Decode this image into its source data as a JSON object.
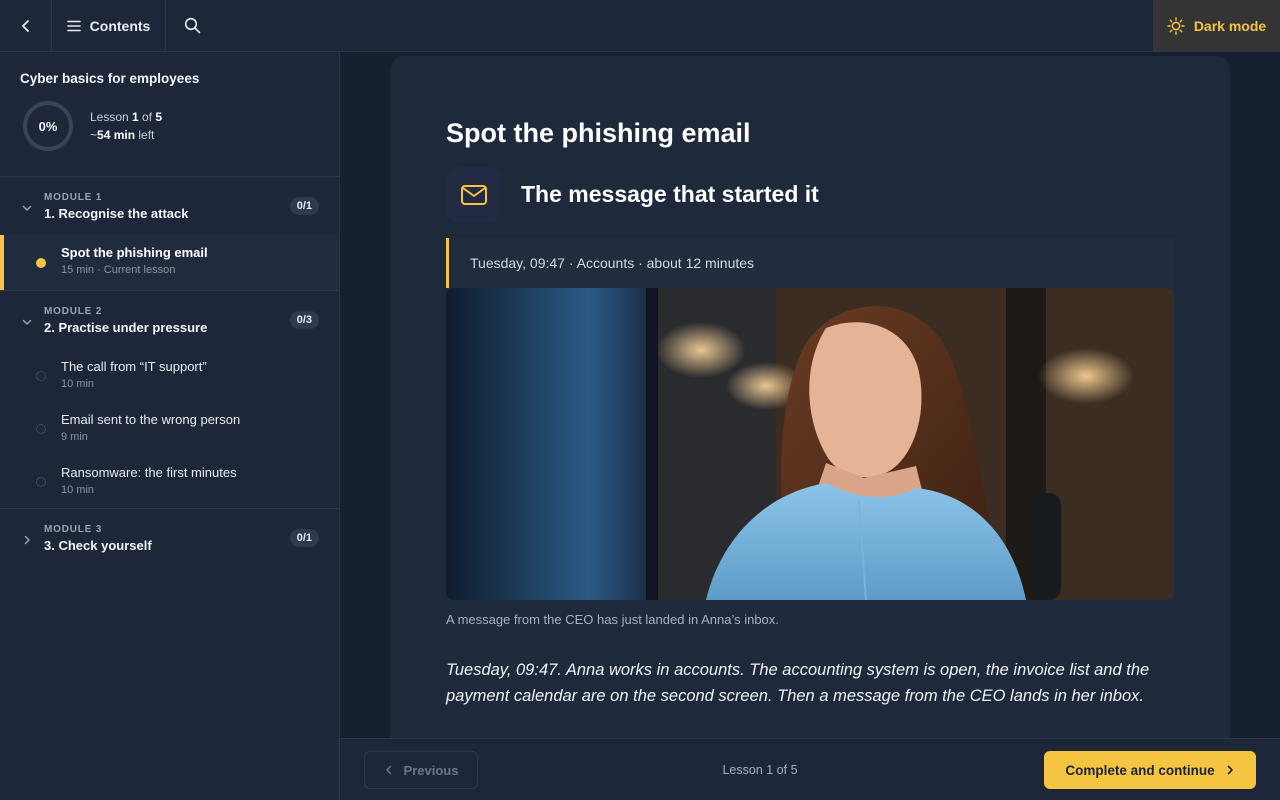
{
  "topbar": {
    "contents_label": "Contents",
    "dark_mode_label": "Dark mode"
  },
  "course": {
    "title": "Cyber basics for employees",
    "progress_percent": "0%",
    "lesson_prefix": "Lesson ",
    "lesson_current": "1",
    "lesson_of": " of ",
    "lesson_total": "5",
    "time_prefix": "~",
    "time_left": "54 min",
    "time_suffix": " left"
  },
  "modules": [
    {
      "kicker": "MODULE 1",
      "title": "1. Recognise the attack",
      "count": "0/1",
      "lessons": [
        {
          "name": "Spot the phishing email",
          "sub": "15 min · Current lesson"
        }
      ]
    },
    {
      "kicker": "MODULE 2",
      "title": "2. Practise under pressure",
      "count": "0/3",
      "lessons": [
        {
          "name": "The call from “IT support”",
          "sub": "10 min"
        },
        {
          "name": "Email sent to the wrong person",
          "sub": "9 min"
        },
        {
          "name": "Ransomware: the first minutes",
          "sub": "10 min"
        }
      ]
    },
    {
      "kicker": "MODULE 3",
      "title": "3. Check yourself",
      "count": "0/1"
    }
  ],
  "lesson": {
    "title": "Spot the phishing email",
    "section_title": "The message that started it",
    "meta": "Tuesday, 09:47 · Accounts · about 12 minutes",
    "caption": "A message from the CEO has just landed in Anna’s inbox.",
    "body": "Tuesday, 09:47. Anna works in accounts. The accounting system is open, the invoice list and the payment calendar are on the second screen. Then a message from the CEO lands in her inbox."
  },
  "footer": {
    "prev_label": "Previous",
    "position": "Lesson 1 of 5",
    "next_label": "Complete and continue"
  },
  "colors": {
    "accent": "#f5c542",
    "background": "#1b2436"
  }
}
